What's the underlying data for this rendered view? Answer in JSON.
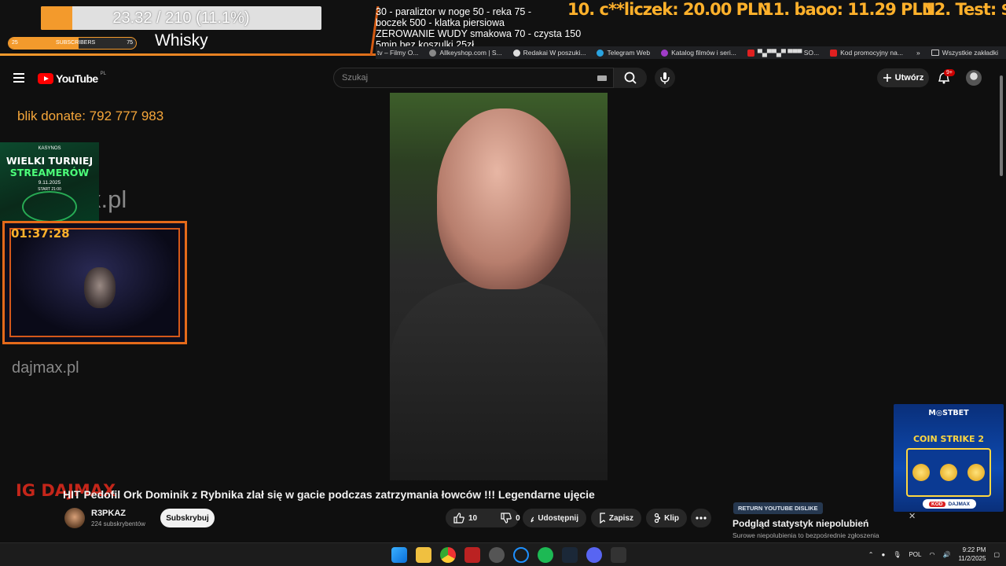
{
  "stream_overlay": {
    "goal_text": "23.32 / 210 (11.1%)",
    "goal_progress": 0.111,
    "subs_bar": {
      "min": "25",
      "label": "SUBSCRIBERS",
      "max": "75",
      "progress": 0.55
    },
    "goal_name": "Whisky",
    "lines": [
      "30 - paraliztor w noge 50 - reka 75 -",
      " boczek 500 - klatka piersiowa",
      "ZEROWANIE WUDY smakowa 70 - czysta 150",
      "5min bez koszulki 25zł"
    ],
    "ranks": [
      "10. c**liczek: 20.00 PLN",
      "11. baoo: 11.29 PLN",
      "12. Test: $"
    ],
    "accent": "#f39a2c"
  },
  "bookmarks": {
    "items": [
      "tv – Filmy O...",
      "Allkeyshop.com | S...",
      "Redakai W poszuki...",
      "Telegram Web",
      "Katalog filmów i seri...",
      "▀▄▀▀▄▀ ▀▀▀ SO...",
      "Kod promocyjny na..."
    ],
    "more": "»",
    "all": "Wszystkie zakładki"
  },
  "youtube": {
    "brand": "YouTube",
    "region": "PL",
    "search_placeholder": "Szukaj",
    "create_label": "Utwórz",
    "notif_count": "9+",
    "brand_color": "#ff0000"
  },
  "left_overlay": {
    "blik": "blik donate: 792 777 983",
    "site_big": "x.pl",
    "site_small": "dajmax.pl",
    "promo": {
      "brand": "KASYNOS",
      "line1": "WIELKI TURNIEJ",
      "line2": "STREAMERÓW",
      "date": "9.11.2025",
      "start": "START 21:00"
    },
    "timer": "01:37:28"
  },
  "video": {
    "ig_overlay": "IG DAJMAX",
    "title": "HIT Pedofil Ork Dominik z Rybnika zlał się w gacie podczas zatrzymania łowców !!! Legendarne ujęcie",
    "channel": "R3PKAZ",
    "subscribers": "224 subskrybentów",
    "subscribe_label": "Subskrybuj",
    "likes": "10",
    "dislikes": "0",
    "share_label": "Udostępnij",
    "save_label": "Zapisz",
    "clip_label": "Klip"
  },
  "ryd": {
    "badge": "RETURN YOUTUBE DISLIKE",
    "title": "Podgląd statystyk niepolubień",
    "subtitle": "Surowe niepolubienia to bezpośrednie zgłoszenia"
  },
  "mostbet": {
    "logo": "M◎STBET",
    "game": "COIN STRIKE 2",
    "tag_brand": "DAJMAX",
    "tag_prefix": "KOD"
  },
  "taskbar": {
    "lang": "POL",
    "time": "9:22 PM",
    "date": "11/2/2025"
  }
}
